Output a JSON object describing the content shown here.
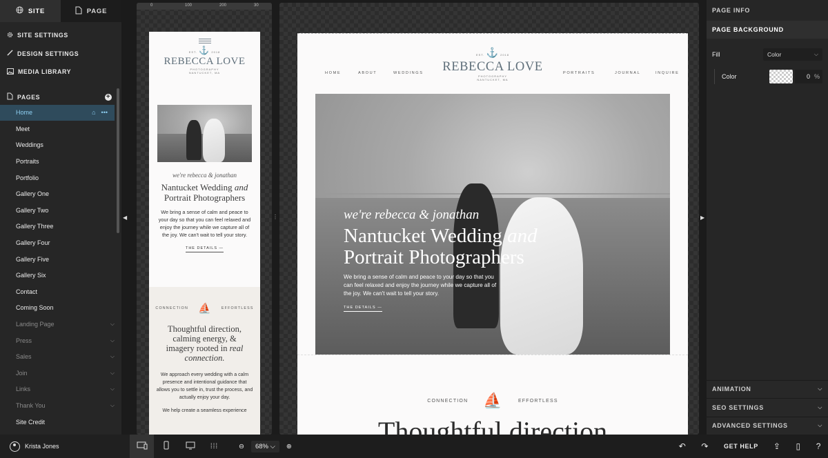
{
  "left_panel": {
    "tabs": [
      {
        "label": "SITE"
      },
      {
        "label": "PAGE"
      }
    ],
    "links": [
      {
        "label": "SITE SETTINGS"
      },
      {
        "label": "DESIGN SETTINGS"
      },
      {
        "label": "MEDIA LIBRARY"
      }
    ],
    "pages_title": "PAGES",
    "pages": [
      {
        "label": "Home"
      },
      {
        "label": "Meet"
      },
      {
        "label": "Weddings"
      },
      {
        "label": "Portraits"
      },
      {
        "label": "Portfolio"
      },
      {
        "label": "Gallery One"
      },
      {
        "label": "Gallery Two"
      },
      {
        "label": "Gallery Three"
      },
      {
        "label": "Gallery Four"
      },
      {
        "label": "Gallery Five"
      },
      {
        "label": "Gallery Six"
      },
      {
        "label": "Contact"
      },
      {
        "label": "Coming Soon"
      },
      {
        "label": "Landing Page"
      },
      {
        "label": "Press"
      },
      {
        "label": "Sales"
      },
      {
        "label": "Join"
      },
      {
        "label": "Links"
      },
      {
        "label": "Thank You"
      },
      {
        "label": "Site Credit"
      }
    ]
  },
  "ruler": {
    "ticks": [
      "0",
      "100",
      "200",
      "30"
    ]
  },
  "site": {
    "logo_small_left": "EST.",
    "logo_small_right": "2018",
    "logo_name": "REBECCA LOVE",
    "logo_sub": "PHOTOGRAPHY",
    "logo_location": "NANTUCKET, MA",
    "nav_left": [
      "HOME",
      "ABOUT",
      "WEDDINGS"
    ],
    "nav_right": [
      "PORTRAITS",
      "JOURNAL",
      "INQUIRE"
    ],
    "intro_script": "we're rebecca & jonathan",
    "intro_heading_1": "Nantucket Wedding",
    "intro_heading_italic": "and",
    "intro_heading_2": "Portrait Photographers",
    "intro_paragraph": "We bring a sense of calm and peace to your day so that you can feel relaxed and enjoy the journey while we capture all of the joy. We can't wait to tell your story.",
    "details_link": "THE DETAILS —",
    "connection_left": "CONNECTION",
    "connection_right": "EFFORTLESS",
    "section_heading": "Thoughtful direction, calming energy, & imagery rooted in",
    "section_heading_italic": "real connection.",
    "section_paragraph": "We approach every wedding with a calm presence and intentional guidance that allows you to settle in, trust the process, and actually enjoy your day.",
    "section_paragraph_2": "We help create a seamless experience",
    "desktop_big_heading": "Thoughtful direction"
  },
  "right_panel": {
    "page_info": "PAGE INFO",
    "page_background": "PAGE BACKGROUND",
    "fill_label": "Fill",
    "fill_value": "Color",
    "color_label": "Color",
    "opacity_value": "0",
    "opacity_unit": "%",
    "accordions": [
      {
        "label": "ANIMATION"
      },
      {
        "label": "SEO SETTINGS"
      },
      {
        "label": "ADVANCED SETTINGS"
      }
    ]
  },
  "bottom_bar": {
    "user_name": "Krista Jones",
    "zoom_value": "68%",
    "get_help": "GET HELP"
  },
  "icons": [
    "globe-icon",
    "page-icon",
    "gear-icon",
    "pen-icon",
    "image-icon",
    "pages-icon",
    "plus-icon",
    "home-icon",
    "more-icon",
    "chevron-down-icon",
    "anchor-icon",
    "sailboat-icon",
    "desktop-icon",
    "mobile-icon",
    "monitor-icon",
    "grid-icon",
    "zoom-out-icon",
    "zoom-in-icon",
    "undo-icon",
    "redo-icon",
    "publish-icon",
    "book-icon",
    "chat-icon"
  ],
  "colors": {
    "active_page_bg": "#2f4b5c",
    "active_page_text": "#8fd0f3",
    "logo_text": "#5f6f7a",
    "section_bg": "#f1eeea"
  }
}
